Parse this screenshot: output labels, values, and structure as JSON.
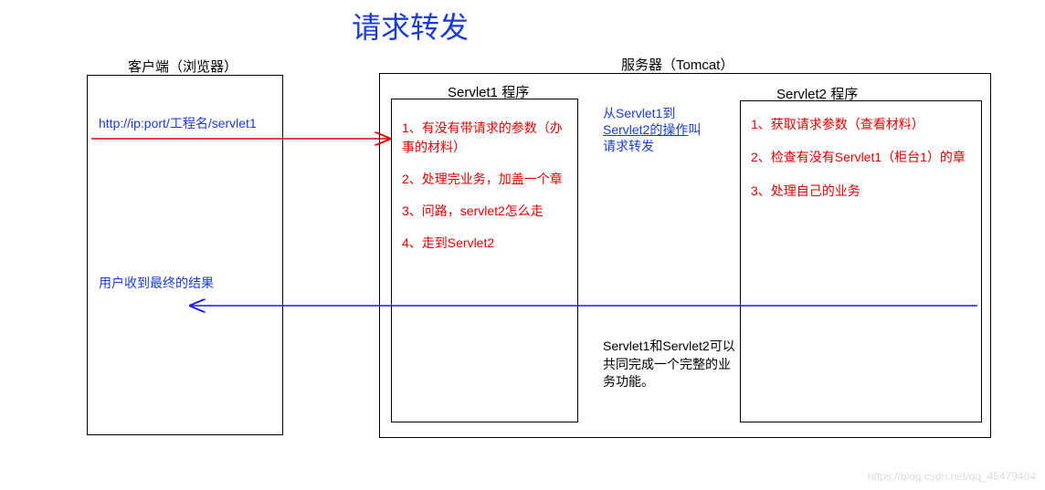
{
  "title": "请求转发",
  "client_label": "客户端（浏览器）",
  "server_label": "服务器（Tomcat）",
  "servlet1_label": "Servlet1 程序",
  "servlet2_label": "Servlet2 程序",
  "client": {
    "url": "http://ip:port/工程名/servlet1",
    "result": "用户收到最终的结果"
  },
  "servlet1_steps": {
    "s1": "1、有没有带请求的参数（办事的材料）",
    "s2": "2、处理完业务，加盖一个章",
    "s3": "3、问路，servlet2怎么走",
    "s4": "4、走到Servlet2"
  },
  "servlet2_steps": {
    "s1": "1、获取请求参数（查看材料）",
    "s2": "2、检查有没有Servlet1（柜台1）的章",
    "s3": "3、处理自己的业务"
  },
  "forward_note": {
    "line1": "从Servlet1到",
    "line2a": "Servlet2的操作",
    "line2b": "叫",
    "line3": "请求转发"
  },
  "bottom_note": "Servlet1和Servlet2可以共同完成一个完整的业务功能。",
  "watermark": "https://blog.csdn.net/qq_45479404",
  "colors": {
    "title_blue": "#1a3cd6",
    "step_red": "#e60000",
    "arrow_request": "#e60000",
    "arrow_response": "#1a1ae6"
  }
}
